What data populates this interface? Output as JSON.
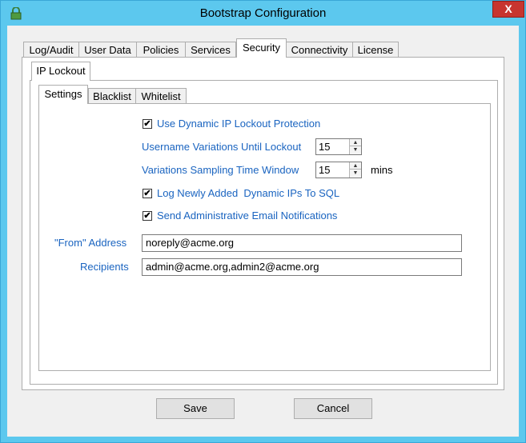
{
  "window": {
    "title": "Bootstrap Configuration",
    "close_glyph": "X",
    "icon": "app-lock-icon"
  },
  "main_tabs": [
    {
      "label": "Log/Audit"
    },
    {
      "label": "User Data"
    },
    {
      "label": "Policies"
    },
    {
      "label": "Services"
    },
    {
      "label": "Security",
      "active": true
    },
    {
      "label": "Connectivity"
    },
    {
      "label": "License"
    }
  ],
  "security_tabs": [
    {
      "label": "IP Lockout",
      "active": true
    }
  ],
  "lockout_tabs": [
    {
      "label": "Settings",
      "active": true
    },
    {
      "label": "Blacklist"
    },
    {
      "label": "Whitelist"
    }
  ],
  "settings": {
    "use_dynamic": {
      "label": "Use Dynamic IP Lockout Protection",
      "checked": true
    },
    "username_variations": {
      "label": "Username Variations Until Lockout",
      "value": "15"
    },
    "sampling_window": {
      "label": "Variations Sampling Time Window",
      "value": "15",
      "unit": "mins"
    },
    "log_sql": {
      "label": "Log Newly Added  Dynamic IPs To SQL",
      "checked": true
    },
    "email_notify": {
      "label": "Send Administrative Email Notifications",
      "checked": true
    },
    "from_address": {
      "label": "\"From\" Address",
      "value": "noreply@acme.org"
    },
    "recipients": {
      "label": "Recipients",
      "value": "admin@acme.org,admin2@acme.org"
    }
  },
  "check_glyph": "✔",
  "spin_up_glyph": "▲",
  "spin_down_glyph": "▼",
  "buttons": {
    "save": "Save",
    "cancel": "Cancel"
  }
}
